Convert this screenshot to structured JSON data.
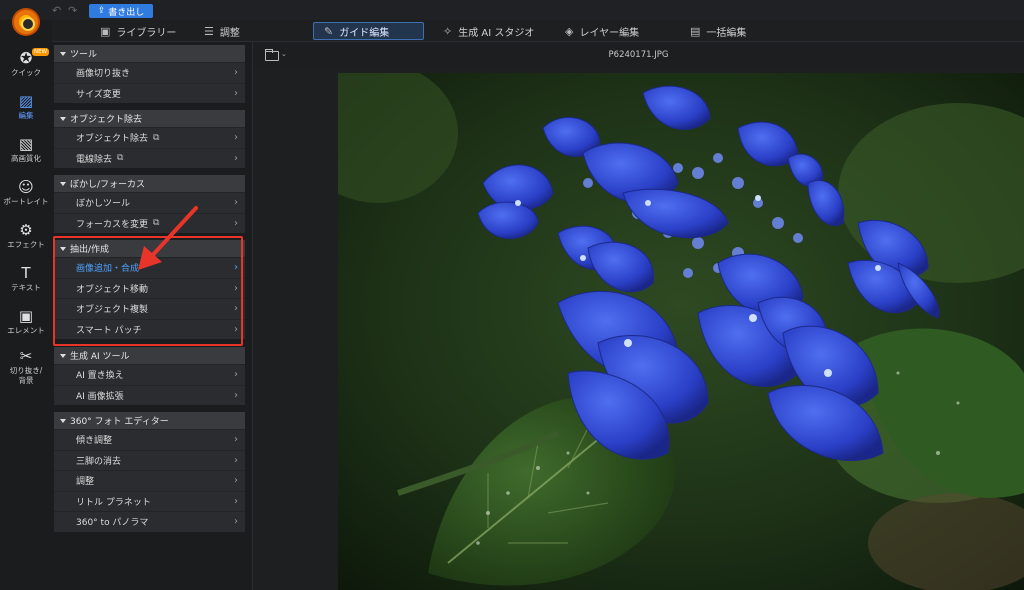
{
  "header": {
    "undo_icon": "undo-icon",
    "redo_icon": "redo-icon",
    "export_label": "書き出し"
  },
  "tabs": [
    {
      "label": "ライブラリー",
      "icon": "library-icon"
    },
    {
      "label": "調整",
      "icon": "sliders-icon"
    },
    {
      "label": "ガイド編集",
      "icon": "wand-icon",
      "active": true
    },
    {
      "label": "生成 AI スタジオ",
      "icon": "sparkle-icon"
    },
    {
      "label": "レイヤー編集",
      "icon": "layers-icon"
    },
    {
      "label": "一括編集",
      "icon": "batch-icon"
    }
  ],
  "rail": [
    {
      "label": "クイック",
      "icon": "quick-icon",
      "badge": "NEW"
    },
    {
      "label": "編集",
      "icon": "edit-icon",
      "active": true
    },
    {
      "label": "高画質化",
      "icon": "enhance-icon"
    },
    {
      "label": "ポートレイト",
      "icon": "portrait-icon"
    },
    {
      "label": "エフェクト",
      "icon": "effect-icon"
    },
    {
      "label": "テキスト",
      "icon": "text-icon"
    },
    {
      "label": "エレメント",
      "icon": "element-icon"
    },
    {
      "label": "切り抜き/",
      "label2": "背景",
      "icon": "cutout-icon"
    }
  ],
  "groups": [
    {
      "title": "ツール",
      "items": [
        {
          "label": "画像切り抜き"
        },
        {
          "label": "サイズ変更"
        }
      ]
    },
    {
      "title": "オブジェクト除去",
      "items": [
        {
          "label": "オブジェクト除去",
          "ai": true
        },
        {
          "label": "電線除去",
          "ai": true
        }
      ]
    },
    {
      "title": "ぼかし/フォーカス",
      "items": [
        {
          "label": "ぼかしツール"
        },
        {
          "label": "フォーカスを変更",
          "ai": true
        }
      ]
    },
    {
      "title": "抽出/作成",
      "items": [
        {
          "label": "画像追加・合成",
          "selected": true
        },
        {
          "label": "オブジェクト移動"
        },
        {
          "label": "オブジェクト複製"
        },
        {
          "label": "スマート パッチ"
        }
      ]
    },
    {
      "title": "生成 AI ツール",
      "items": [
        {
          "label": "AI 置き換え"
        },
        {
          "label": "AI 画像拡張"
        }
      ]
    },
    {
      "title": "360° フォト エディター",
      "items": [
        {
          "label": "傾き調整"
        },
        {
          "label": "三脚の消去"
        },
        {
          "label": "調整"
        },
        {
          "label": "リトル プラネット"
        },
        {
          "label": "360° to パノラマ"
        }
      ]
    }
  ],
  "image": {
    "filename": "P6240171.JPG"
  },
  "colors": {
    "accent": "#2f7be0",
    "selected_text": "#4da3ff",
    "highlight": "#e8352a",
    "badge": "#ff9800"
  }
}
